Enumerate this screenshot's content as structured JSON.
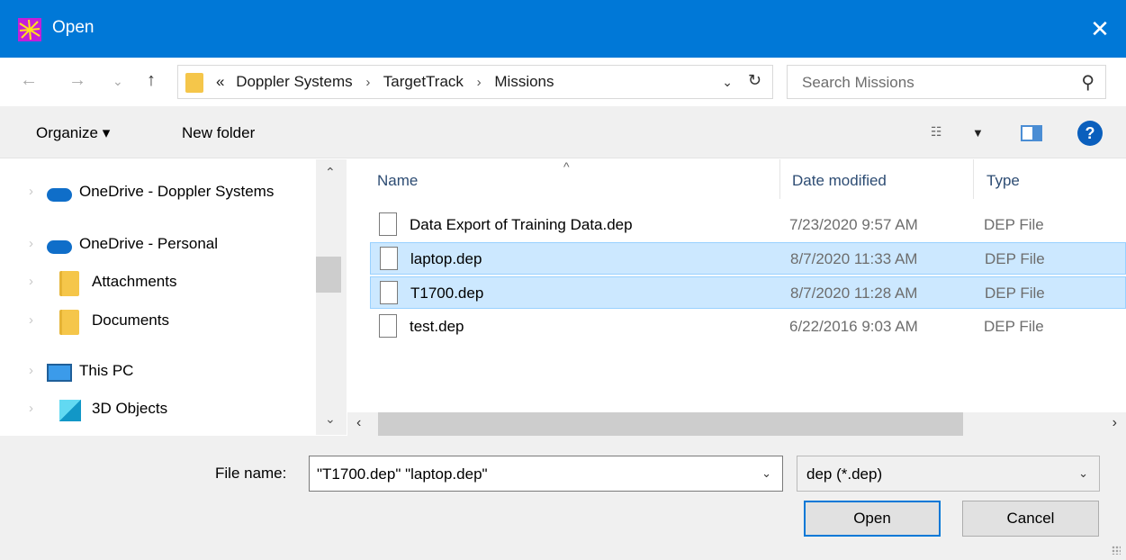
{
  "window": {
    "title": "Open",
    "close_glyph": "✕"
  },
  "nav": {
    "back_glyph": "←",
    "forward_glyph": "→",
    "recent_glyph": "⌄",
    "up_glyph": "↑"
  },
  "address": {
    "overflow": "«",
    "crumbs": [
      "Doppler Systems",
      "TargetTrack",
      "Missions"
    ],
    "separator": "›",
    "dropdown_glyph": "⌄",
    "refresh_glyph": "↻"
  },
  "search": {
    "placeholder": "Search Missions",
    "icon_glyph": "⚲"
  },
  "toolbar": {
    "organize_label": "Organize ▾",
    "new_folder_label": "New folder",
    "view_glyph": "☷",
    "view_dropdown_glyph": "▼",
    "help_glyph": "?"
  },
  "sidebar": {
    "items": [
      {
        "label": "OneDrive - Doppler Systems",
        "icon": "cloud-icon"
      },
      {
        "label": "OneDrive - Personal",
        "icon": "cloud-icon"
      },
      {
        "label": "Attachments",
        "icon": "folder-icon"
      },
      {
        "label": "Documents",
        "icon": "folder-icon"
      },
      {
        "label": "This PC",
        "icon": "monitor-icon"
      },
      {
        "label": "3D Objects",
        "icon": "cube-icon"
      }
    ],
    "chevron_glyph": "›",
    "scroll_up_glyph": "⌃",
    "scroll_down_glyph": "⌄"
  },
  "filelist": {
    "columns": {
      "name": "Name",
      "date": "Date modified",
      "type": "Type"
    },
    "sort_glyph": "^",
    "rows": [
      {
        "name": "Data Export of Training Data.dep",
        "date": "7/23/2020 9:57 AM",
        "type": "DEP File",
        "selected": false
      },
      {
        "name": "laptop.dep",
        "date": "8/7/2020 11:33 AM",
        "type": "DEP File",
        "selected": true
      },
      {
        "name": "T1700.dep",
        "date": "8/7/2020 11:28 AM",
        "type": "DEP File",
        "selected": true
      },
      {
        "name": "test.dep",
        "date": "6/22/2016 9:03 AM",
        "type": "DEP File",
        "selected": false
      }
    ],
    "hscroll_left_glyph": "‹",
    "hscroll_right_glyph": "›"
  },
  "bottom": {
    "file_name_label": "File name:",
    "file_name_value": "\"T1700.dep\" \"laptop.dep\"",
    "file_type_value": "dep (*.dep)",
    "dropdown_glyph": "⌄",
    "open_label": "Open",
    "cancel_label": "Cancel"
  },
  "colors": {
    "titlebar": "#0078d7",
    "selection": "#cce8ff",
    "selection_border": "#99d1ff",
    "folder": "#f5c64a"
  }
}
